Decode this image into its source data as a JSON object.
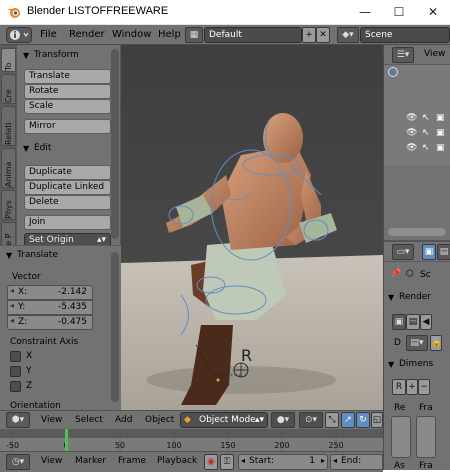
{
  "window": {
    "title": "Blender LISTOFFREEWARE",
    "minimize": "—",
    "maximize": "☐",
    "close": "✕"
  },
  "menubar": {
    "items": [
      "File",
      "Render",
      "Window",
      "Help"
    ],
    "screen_layout": "Default",
    "scene": "Scene"
  },
  "tool_tabs": [
    "To",
    "Cre",
    "Relati",
    "Anima",
    "Phys",
    "Grease P"
  ],
  "tool_shelf": {
    "transform_header": "Transform",
    "transform_buttons": [
      "Translate",
      "Rotate",
      "Scale"
    ],
    "mirror": "Mirror",
    "edit_header": "Edit",
    "edit_buttons": [
      "Duplicate",
      "Duplicate Linked",
      "Delete"
    ],
    "join": "Join",
    "set_origin": "Set Origin"
  },
  "operator_panel": {
    "header": "Translate",
    "vector_label": "Vector",
    "x_label": "X:",
    "x_value": "-2.142",
    "y_label": "Y:",
    "y_value": "-5.435",
    "z_label": "Z:",
    "z_value": "-0.475",
    "constraint_label": "Constraint Axis",
    "axes": [
      "X",
      "Y",
      "Z"
    ],
    "orientation_label": "Orientation"
  },
  "outliner": {
    "view_label": "View"
  },
  "properties": {
    "scene_label": "Sc",
    "render_header": "Render",
    "display_value": "D",
    "dimensions_header": "Dimens",
    "resolution_value": "R",
    "col1_label": "Re",
    "col2_label": "Fra",
    "col3_label": "As",
    "col4_label": "Fra"
  },
  "viewport_header": {
    "items": [
      "View",
      "Select",
      "Add",
      "Object"
    ],
    "mode": "Object Mode"
  },
  "timeline": {
    "ticks": [
      "-50",
      "0",
      "50",
      "100",
      "150",
      "200",
      "250"
    ],
    "current_frame": 0
  },
  "timeline_header": {
    "items": [
      "View",
      "Marker",
      "Frame",
      "Playback"
    ],
    "start_label": "Start:",
    "start_value": "1",
    "end_label": "End:"
  },
  "colors": {
    "panel": "#727272",
    "viewport_bg": "#444444",
    "floor": "#b8b2a8",
    "accent_blue": "#5e8ec4",
    "current_frame_green": "#50c050"
  }
}
